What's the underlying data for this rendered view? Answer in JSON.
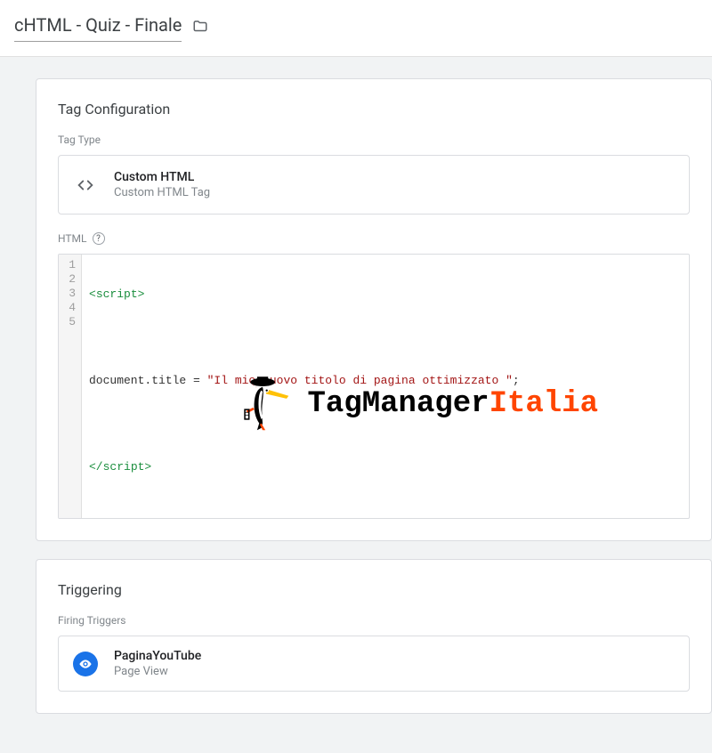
{
  "header": {
    "title": "cHTML - Quiz - Finale"
  },
  "tagConfig": {
    "title": "Tag Configuration",
    "typeLabel": "Tag Type",
    "type": {
      "name": "Custom HTML",
      "subtitle": "Custom HTML Tag"
    },
    "htmlLabel": "HTML",
    "code": {
      "lines": [
        "1",
        "2",
        "3",
        "4",
        "5"
      ],
      "line1_pre": "<",
      "line1_tag": "script",
      "line1_post": ">",
      "line3_prefix": "document.title = ",
      "line3_string": "\"Il mio nuovo titolo di pagina ottimizzato \"",
      "line3_suffix": ";",
      "line5_pre": "</",
      "line5_tag": "script",
      "line5_post": ">"
    },
    "logo": {
      "text1": "TagManager",
      "text2": "Italia"
    }
  },
  "triggering": {
    "title": "Triggering",
    "firingLabel": "Firing Triggers",
    "trigger": {
      "name": "PaginaYouTube",
      "type": "Page View"
    }
  }
}
